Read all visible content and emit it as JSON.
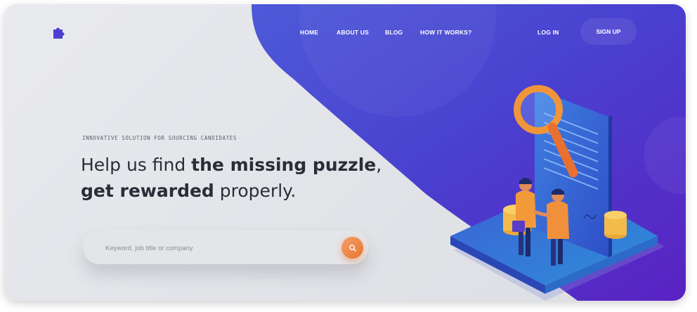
{
  "nav": {
    "home": "HOME",
    "about": "ABOUT US",
    "blog": "BLOG",
    "how": "HOW IT WORKS?",
    "login": "LOG IN",
    "signup": "SIGN UP"
  },
  "hero": {
    "kicker": "INNOVATIVE SOLUTION FOR SOURCING CANDIDATES",
    "line1_pre": "Help us find ",
    "line1_bold": "the missing puzzle",
    "line1_post": ",",
    "line2_bold": "get rewarded",
    "line2_post": " properly."
  },
  "search": {
    "placeholder": "Keyword, job title or company"
  },
  "icons": {
    "logo": "puzzle-icon",
    "search": "search-icon"
  },
  "colors": {
    "accent_purple": "#5232d0",
    "accent_blue": "#3d5ad6",
    "accent_orange": "#ee8a3f",
    "background": "#e3e4e8"
  }
}
